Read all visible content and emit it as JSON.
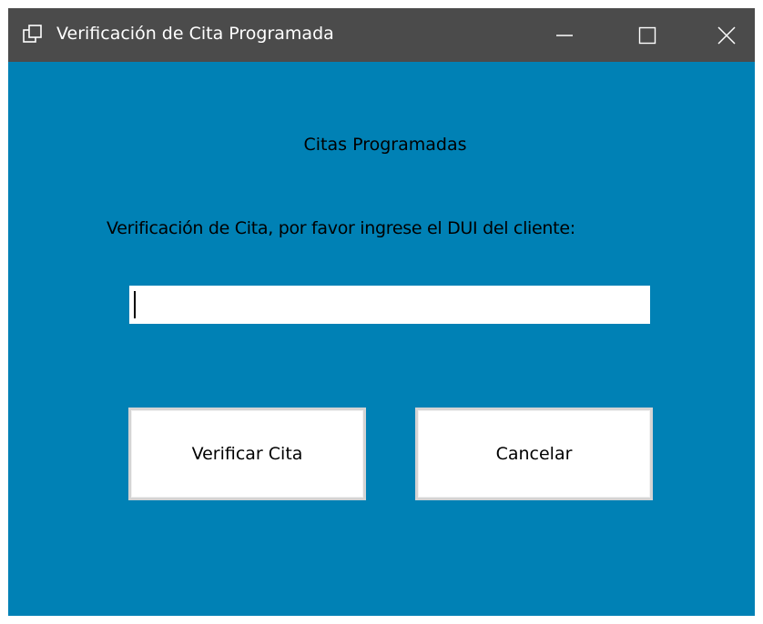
{
  "window": {
    "title": "Verificación de Cita Programada",
    "background_color": "#0081b5",
    "titlebar_color": "#4b4b4b",
    "icons": {
      "app": "app-window-icon",
      "minimize": "minimize-icon",
      "maximize": "maximize-icon",
      "close": "close-icon"
    }
  },
  "form": {
    "heading": "Citas Programadas",
    "prompt": "Verificación de Cita, por favor ingrese el DUI del cliente:",
    "dui_input": {
      "value": "",
      "placeholder": ""
    },
    "buttons": {
      "verify_label": "Verificar Cita",
      "cancel_label": "Cancelar"
    }
  }
}
